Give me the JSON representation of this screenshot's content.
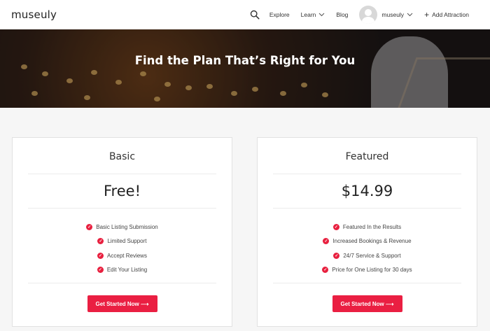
{
  "header": {
    "logo": "museuly",
    "nav": {
      "search_icon": "search-icon",
      "explore": "Explore",
      "learn": "Learn",
      "blog": "Blog",
      "user": "museuly",
      "add_attraction": "Add Attraction"
    }
  },
  "hero": {
    "title": "Find the Plan That’s Right for You"
  },
  "plans": [
    {
      "name": "Basic",
      "price": "Free!",
      "features": [
        "Basic Listing Submission",
        "Limited Support",
        "Accept Reviews",
        "Edit Your Listing"
      ],
      "button": "Get Started Now ⟶"
    },
    {
      "name": "Featured",
      "price": "$14.99",
      "features": [
        "Featured In the Results",
        "Increased Bookings & Revenue",
        "24/7 Service & Support",
        "Price for One Listing for 30 days"
      ],
      "button": "Get Started Now ⟶"
    }
  ],
  "colors": {
    "accent": "#ea1f42",
    "background": "#f6f6f6"
  }
}
